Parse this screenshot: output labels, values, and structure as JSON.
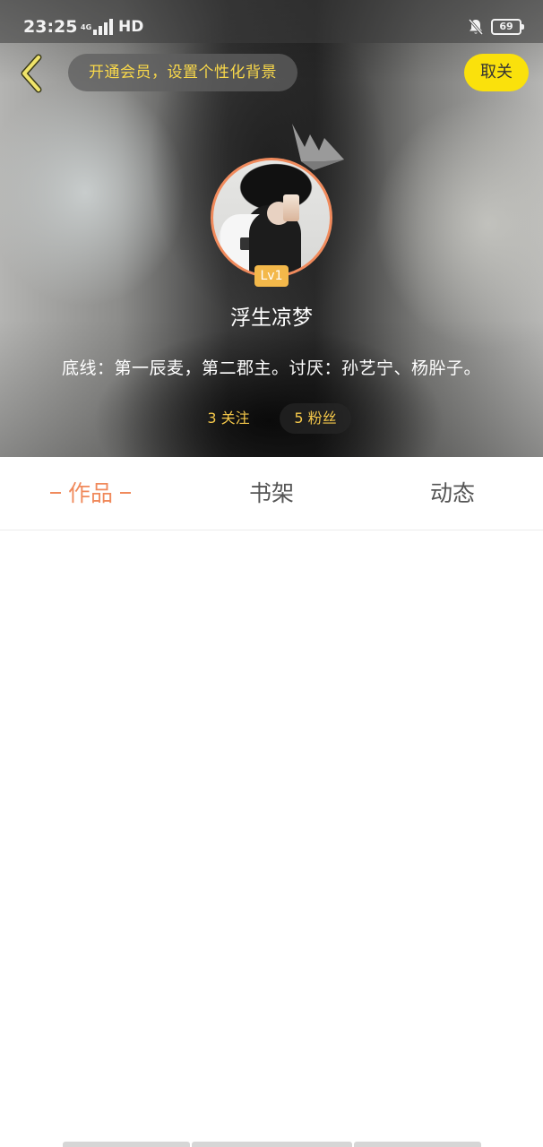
{
  "status_bar": {
    "time": "23:25",
    "network": "4G",
    "hd": "HD",
    "battery": "69",
    "icons": [
      "signal-icon",
      "bell-off-icon",
      "battery-icon"
    ]
  },
  "header": {
    "back_icon": "chevron-left-icon",
    "vip_banner": "开通会员，设置个性化背景",
    "follow_button": "取关"
  },
  "profile": {
    "avatar": "avatar-photo",
    "crown_icon": "crown-icon",
    "level": "Lv1",
    "nickname": "浮生凉梦",
    "bio": "底线：第一辰麦，第二郡主。讨厌：孙艺宁、杨肸子。",
    "following": "3 关注",
    "fans": "5 粉丝"
  },
  "tabs": [
    {
      "label": "作品",
      "active": true
    },
    {
      "label": "书架",
      "active": false
    },
    {
      "label": "动态",
      "active": false
    }
  ],
  "colors": {
    "accent": "#f08a5c",
    "yellow_button": "#fae10c",
    "gold_text": "#f5c84a",
    "level_badge": "#f3b84a"
  }
}
